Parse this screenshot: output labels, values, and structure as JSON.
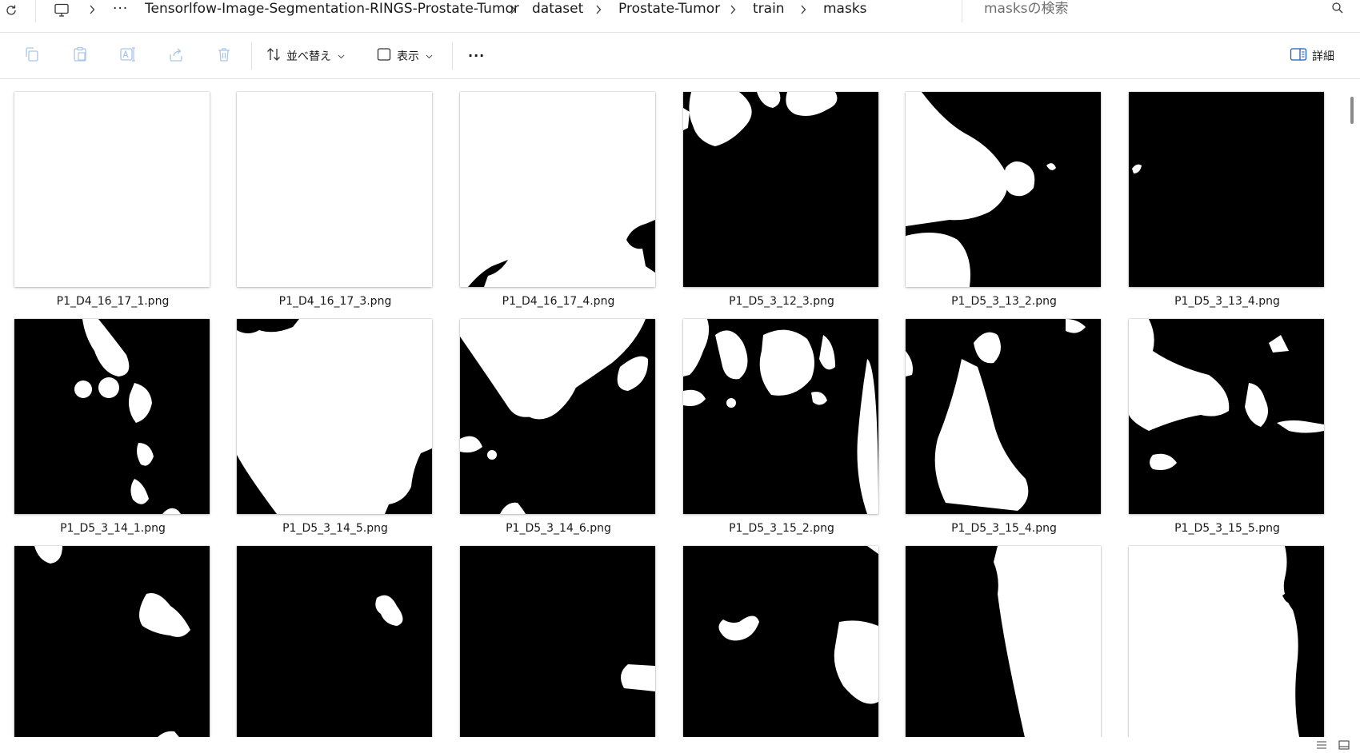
{
  "address_bar": {
    "breadcrumbs": [
      "Tensorlfow-Image-Segmentation-RINGS-Prostate-Tumor",
      "dataset",
      "Prostate-Tumor",
      "train",
      "masks"
    ],
    "overflow_label": "···",
    "search_placeholder": "masksの検索"
  },
  "toolbar": {
    "sort_label": "並べ替え",
    "view_label": "表示",
    "more_label": "···",
    "details_label": "詳細"
  },
  "files": [
    {
      "name": "P1_D4_16_17_1.png",
      "bg": "#ffffff"
    },
    {
      "name": "P1_D4_16_17_3.png",
      "bg": "#ffffff"
    },
    {
      "name": "P1_D4_16_17_4.png",
      "bg": "#ffffff"
    },
    {
      "name": "P1_D5_3_12_3.png",
      "bg": "#000000"
    },
    {
      "name": "P1_D5_3_13_2.png",
      "bg": "#000000"
    },
    {
      "name": "P1_D5_3_13_4.png",
      "bg": "#000000"
    },
    {
      "name": "P1_D5_3_14_1.png",
      "bg": "#000000"
    },
    {
      "name": "P1_D5_3_14_5.png",
      "bg": "#ffffff"
    },
    {
      "name": "P1_D5_3_14_6.png",
      "bg": "#000000"
    },
    {
      "name": "P1_D5_3_15_2.png",
      "bg": "#000000"
    },
    {
      "name": "P1_D5_3_15_4.png",
      "bg": "#000000"
    },
    {
      "name": "P1_D5_3_15_5.png",
      "bg": "#000000"
    },
    {
      "name": "",
      "bg": "#000000"
    },
    {
      "name": "",
      "bg": "#000000"
    },
    {
      "name": "",
      "bg": "#000000"
    },
    {
      "name": "",
      "bg": "#000000"
    },
    {
      "name": "",
      "bg": "#000000"
    },
    {
      "name": "",
      "bg": "#ffffff"
    }
  ],
  "colors": {
    "mask_foreground": "#ffffff",
    "mask_background": "#000000",
    "border": "#e3e3e3",
    "text": "#1a1a1a",
    "placeholder": "#6f6f6f"
  }
}
